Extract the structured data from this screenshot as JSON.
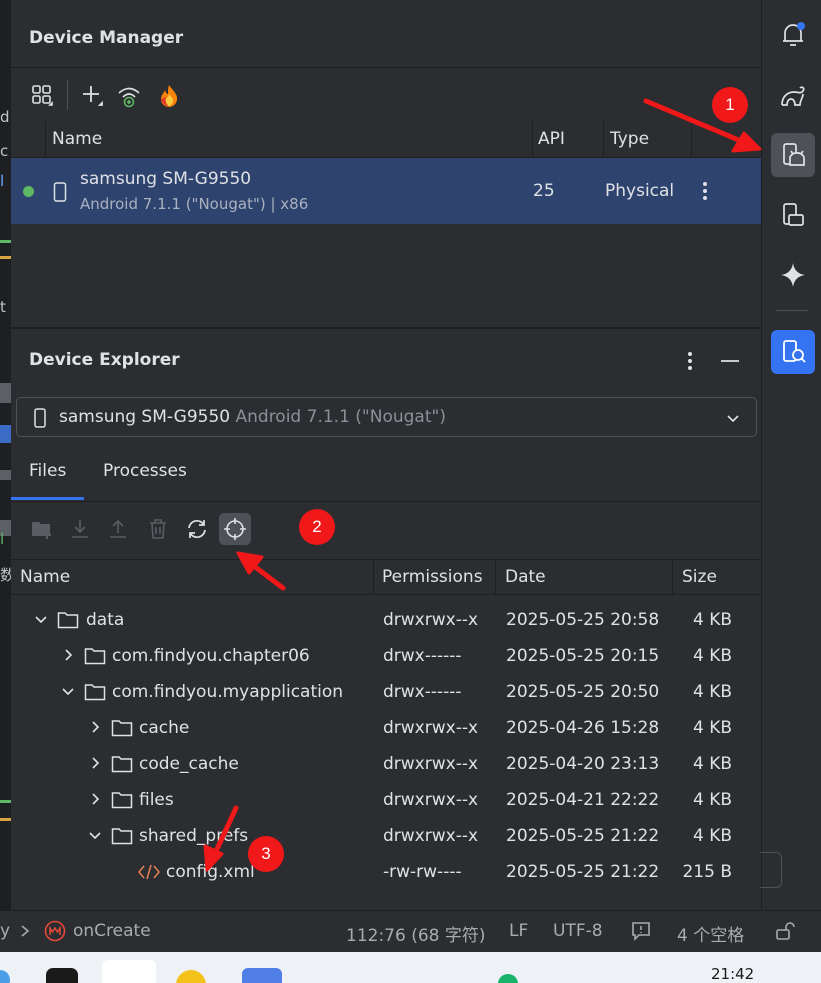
{
  "device_manager": {
    "title": "Device Manager",
    "columns": [
      "Name",
      "API",
      "Type"
    ],
    "device": {
      "name": "samsung SM-G9550",
      "subtitle": "Android 7.1.1 (\"Nougat\") | x86",
      "api": "25",
      "type": "Physical",
      "status_color": "#5fb865"
    }
  },
  "device_explorer": {
    "title": "Device Explorer",
    "selector": {
      "device": "samsung SM-G9550",
      "version": "Android 7.1.1 (\"Nougat\")"
    },
    "tabs": [
      "Files",
      "Processes"
    ],
    "active_tab": "Files",
    "columns": [
      "Name",
      "Permissions",
      "Date",
      "Size"
    ],
    "rows": [
      {
        "name": "data",
        "perm": "drwxrwx--x",
        "date": "2025-05-25 20:58",
        "size": "4 KB"
      },
      {
        "name": "com.findyou.chapter06",
        "perm": "drwx------",
        "date": "2025-05-25 20:15",
        "size": "4 KB"
      },
      {
        "name": "com.findyou.myapplication",
        "perm": "drwx------",
        "date": "2025-05-25 20:50",
        "size": "4 KB"
      },
      {
        "name": "cache",
        "perm": "drwxrwx--x",
        "date": "2025-04-26 15:28",
        "size": "4 KB"
      },
      {
        "name": "code_cache",
        "perm": "drwxrwx--x",
        "date": "2025-04-20 23:13",
        "size": "4 KB"
      },
      {
        "name": "files",
        "perm": "drwxrwx--x",
        "date": "2025-04-21 22:22",
        "size": "4 KB"
      },
      {
        "name": "shared_prefs",
        "perm": "drwxrwx--x",
        "date": "2025-05-25 21:22",
        "size": "4 KB"
      },
      {
        "name": "config.xml",
        "perm": "-rw-rw----",
        "date": "2025-05-25 21:22",
        "size": "215 B"
      }
    ]
  },
  "status_bar": {
    "crumb_prefix": "y",
    "method": "onCreate",
    "position": "112:76 (68 字符)",
    "line_ending": "LF",
    "encoding": "UTF-8",
    "indent": "4 个空格"
  },
  "taskbar": {
    "clock": "21:42"
  },
  "annotations": {
    "badge1": "1",
    "badge2": "2",
    "badge3": "3",
    "color": "#f01818"
  },
  "colors": {
    "accent": "#3574f0",
    "selected_row": "#2e436e",
    "xml_icon": "#e07b53"
  }
}
